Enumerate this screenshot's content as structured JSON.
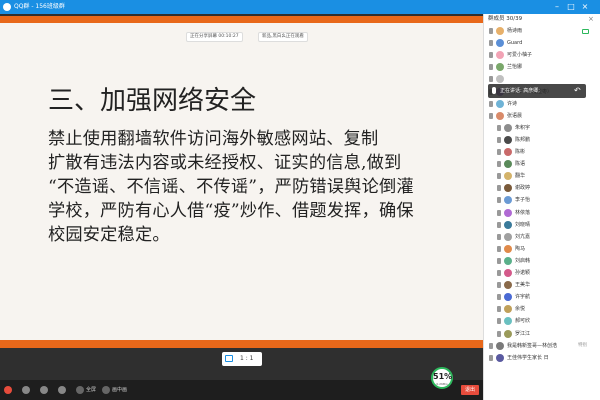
{
  "window": {
    "title": "QQ群 - 156班级群",
    "minimize": "–",
    "maximize": "□",
    "close": "×"
  },
  "status": {
    "recording": "正在分享屏幕 00:10:27",
    "speaking": "新品,黑白幺正在观看"
  },
  "slide": {
    "title": "三、加强网络安全",
    "lines": [
      "    禁止使用翻墙软件访问海外敏感网站、复制",
      "扩散有违法内容或未经授权、证实的信息,做到",
      "“不造谣、不信谣、不传谣”，严防错误舆论倒灌",
      "学校，严防有心人借“疫”炒作、借题发挥，确保",
      "校园安定稳定。"
    ]
  },
  "zoom": "1 : 1",
  "bottombar": {
    "fullscreen": "全屏",
    "pip": "画中画"
  },
  "meter": {
    "percent": "51%",
    "speed": "0.2KB/s"
  },
  "exit_label": "退出",
  "sidebar": {
    "header": "群成员 30/39",
    "close_icon": "×",
    "speaker_text": "正在讲话: 高彦卿;",
    "undo_icon": "↶",
    "members": [
      {
        "name": "杨诗雨",
        "color": "#e7b06a"
      },
      {
        "name": "Guard",
        "color": "#5b8fd6"
      },
      {
        "name": "可爱小柚子",
        "color": "#f2a3b5"
      },
      {
        "name": "兰怡娜",
        "color": "#7aa86b"
      },
      {
        "name": "",
        "color": "#c0c0c0"
      },
      {
        "name": "李宗舜（木浅拉枣）",
        "color": "#9b7bc7"
      },
      {
        "name": "许诗",
        "color": "#6fb3d6"
      },
      {
        "name": "张语晨",
        "color": "#d98b6a"
      },
      {
        "name": "朱积宇",
        "color": "#8d8d8d"
      },
      {
        "name": "陈邦鹏",
        "color": "#4a4a4a"
      },
      {
        "name": "陈彬",
        "color": "#c96a6a"
      },
      {
        "name": "陈语",
        "color": "#5a8a5a"
      },
      {
        "name": "翻华",
        "color": "#d4b36a"
      },
      {
        "name": "谢政婷",
        "color": "#7a5a3a"
      },
      {
        "name": "李子怡",
        "color": "#6a9ad4"
      },
      {
        "name": "林依落",
        "color": "#b06ad4"
      },
      {
        "name": "刘晓晴",
        "color": "#3a7a9a"
      },
      {
        "name": "刘亢嘉",
        "color": "#a0a0a0"
      },
      {
        "name": "陶马",
        "color": "#e08a4a"
      },
      {
        "name": "刘启韩",
        "color": "#5ab08a"
      },
      {
        "name": "孙诺颖",
        "color": "#d45a8a"
      },
      {
        "name": "王美华",
        "color": "#8a6a4a"
      },
      {
        "name": "许宇航",
        "color": "#4a6ad4"
      },
      {
        "name": "余悦",
        "color": "#c0a05a"
      },
      {
        "name": "郝可欣",
        "color": "#6ac0c0"
      },
      {
        "name": "罗江江",
        "color": "#9a9a5a"
      },
      {
        "name": "我是韩新签哥—林创浩",
        "color": "#7a7a7a"
      },
      {
        "name": "王佳伟学生家长 日",
        "color": "#5a5aa0"
      }
    ],
    "badges": {
      "member0": "",
      "member26": "班主任",
      "member26_right": "特别"
    }
  }
}
